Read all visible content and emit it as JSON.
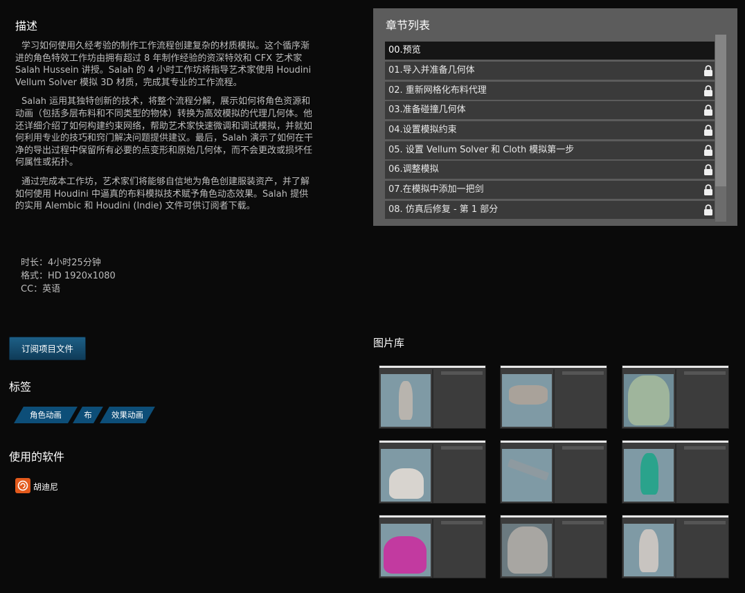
{
  "description": {
    "heading": "描述",
    "paragraphs": [
      "学习如何使用久经考验的制作工作流程创建复杂的材质模拟。这个循序渐进的角色特效工作坊由拥有超过 8 年制作经验的资深特效和 CFX 艺术家 Salah Hussein 讲授。Salah 的 4 小时工作坊将指导艺术家使用 Houdini Vellum Solver 模拟 3D 材质，完成其专业的工作流程。",
      "Salah 运用其独特创新的技术，将整个流程分解，展示如何将角色资源和动画（包括多层布料和不同类型的物体）转换为高效模拟的代理几何体。他还详细介绍了如何构建约束网络，帮助艺术家快速微调和调试模拟，并就如何利用专业的技巧和窍门解决问题提供建议。最后，Salah 演示了如何在干净的导出过程中保留所有必要的点变形和原始几何体，而不会更改或损坏任何属性或拓扑。",
      "通过完成本工作坊，艺术家们将能够自信地为角色创建服装资产，并了解如何使用 Houdini 中逼真的布料模拟技术赋予角色动态效果。Salah 提供的实用 Alembic 和 Houdini (Indie) 文件可供订阅者下载。"
    ],
    "duration": "时长：4小时25分钟",
    "format": "格式：HD 1920x1080",
    "cc": "CC：英语"
  },
  "subscribe_button": "订阅项目文件",
  "tags": {
    "heading": "标签",
    "items": [
      "角色动画",
      "布",
      "效果动画"
    ]
  },
  "software": {
    "heading": "使用的软件",
    "items": [
      {
        "name": "胡迪尼",
        "icon": "houdini-icon",
        "color": "#e35a1c"
      }
    ]
  },
  "chapters": {
    "heading": "章节列表",
    "items": [
      {
        "label": "00.预览",
        "locked": false,
        "active": true
      },
      {
        "label": "01.导入并准备几何体",
        "locked": true
      },
      {
        "label": "02. 重新网格化布料代理",
        "locked": true
      },
      {
        "label": "03.准备碰撞几何体",
        "locked": true
      },
      {
        "label": "04.设置模拟约束",
        "locked": true
      },
      {
        "label": "05. 设置 Vellum Solver 和 Cloth 模拟第一步",
        "locked": true
      },
      {
        "label": "06.调整模拟",
        "locked": true
      },
      {
        "label": "07.在模拟中添加一把剑",
        "locked": true
      },
      {
        "label": "08. 仿真后修复 - 第 1 部分",
        "locked": true
      }
    ]
  },
  "gallery": {
    "heading": "图片库",
    "count": 9
  },
  "colors": {
    "background": "#0a0a0a",
    "accent_button": "#1d5f86",
    "tag": "#0d4e78",
    "panel": "#5c5c5c",
    "chapter_row": "#3a3a3a",
    "chapter_active": "#151515"
  }
}
